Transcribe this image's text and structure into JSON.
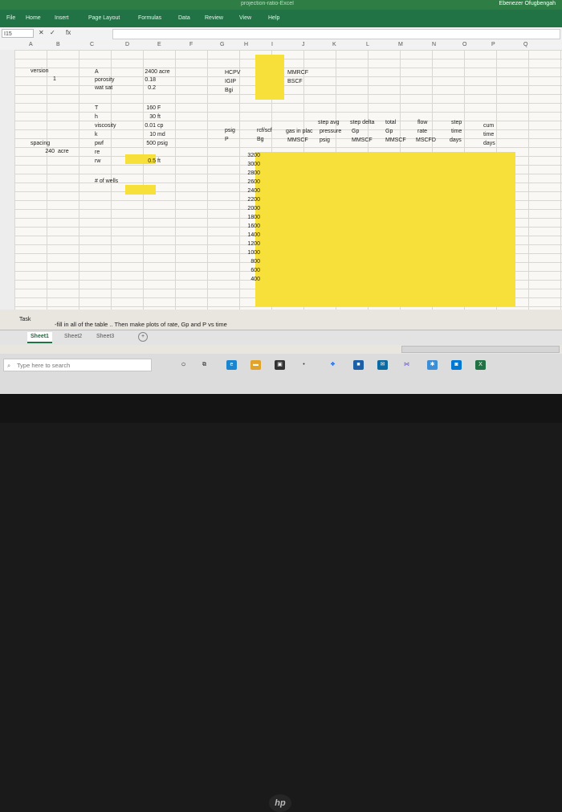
{
  "window": {
    "title": "projection-ratio-Excel",
    "user": "Ebenezer Ofugbengah"
  },
  "ribbon_tabs": [
    "File",
    "Home",
    "Insert",
    "Page Layout",
    "Formulas",
    "Data",
    "Review",
    "View",
    "Help"
  ],
  "name_box": "I15",
  "fx_label": "fx",
  "columns": [
    "A",
    "B",
    "C",
    "D",
    "E",
    "F",
    "G",
    "H",
    "I",
    "J",
    "K",
    "L",
    "M",
    "N",
    "O",
    "P",
    "Q"
  ],
  "cells": {
    "version": "version",
    "version_num": "1",
    "A": "A",
    "A_val": "2400",
    "A_unit": "acre",
    "porosity": "porosity",
    "porosity_val": "0.18",
    "wat_sat": "wat sat",
    "wat_sat_val": "0.2",
    "HCPV": "HCPV",
    "IGIP": "IGIP",
    "Bgi": "Bgi",
    "MMRCF": "MMRCF",
    "BSCF": "BSCF",
    "T": "T",
    "T_val": "160",
    "T_unit": "F",
    "h": "h",
    "h_val": "30",
    "h_unit": "ft",
    "viscosity": "viscosity",
    "viscosity_val": "0.01",
    "viscosity_unit": "cp",
    "k": "k",
    "k_val": "10",
    "k_unit": "md",
    "pwf": "pwf",
    "pwf_val": "500",
    "pwf_unit": "psig",
    "re": "re",
    "rw": "rw",
    "rw_val": "0.5",
    "rw_unit": "ft",
    "spacing": "spacing",
    "spacing_val": "240",
    "spacing_unit": "acre",
    "num_wells": "# of wells",
    "hdr_psig": "psig",
    "hdr_P": "P",
    "hdr_rcf": "rcf/scf",
    "hdr_Bg": "Bg",
    "hdr_step_avg": "step avg",
    "hdr_gas_in_place": "gas in plac",
    "hdr_MMSCF": "MMSCF",
    "hdr_pressure": "pressure",
    "hdr_psig2": "psig",
    "hdr_step_delta": "step delta",
    "hdr_Gp": "Gp",
    "hdr_MMSCF2": "MMSCF",
    "hdr_total": "total",
    "hdr_Gp2": "Gp",
    "hdr_MMSCF3": "MMSCF",
    "hdr_flow": "flow",
    "hdr_rate": "rate",
    "hdr_MSCFD": "MSCFD",
    "hdr_step": "step",
    "hdr_time": "time",
    "hdr_days": "days",
    "hdr_cum": "cum",
    "hdr_time2": "time",
    "hdr_days2": "days"
  },
  "pressures": [
    "3200",
    "3000",
    "2800",
    "2600",
    "2400",
    "2200",
    "2000",
    "1800",
    "1600",
    "1400",
    "1200",
    "1000",
    "800",
    "600",
    "400"
  ],
  "task": {
    "label": "Task",
    "text": "-fill in all of the table .. Then make plots of rate, Gp and P vs time"
  },
  "sheet_tabs": [
    "Sheet1",
    "Sheet2",
    "Sheet3"
  ],
  "taskbar": {
    "search_placeholder": "Type here to search"
  },
  "colors": {
    "highlight": "#f7e03a",
    "excel_green": "#217346"
  },
  "brand": "hp"
}
